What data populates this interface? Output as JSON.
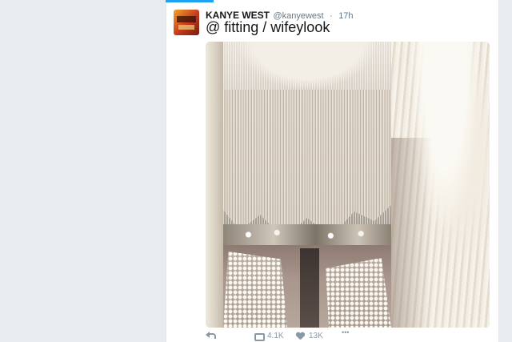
{
  "tweet": {
    "author_name": "KANYE WEST",
    "author_handle": "@kanyewest",
    "separator": "·",
    "time": "17h",
    "text": "@ fitting / wifeylook"
  },
  "actions": {
    "reply_icon": "reply-icon",
    "retweet_icon": "retweet-icon",
    "retweet_count": "4.1K",
    "like_icon": "heart-icon",
    "like_count": "13K",
    "more_icon": "more-icon"
  },
  "colors": {
    "page_background": "#e6ecf0",
    "accent": "#1da1f2",
    "text": "#14171a",
    "secondary_text": "#657786"
  }
}
